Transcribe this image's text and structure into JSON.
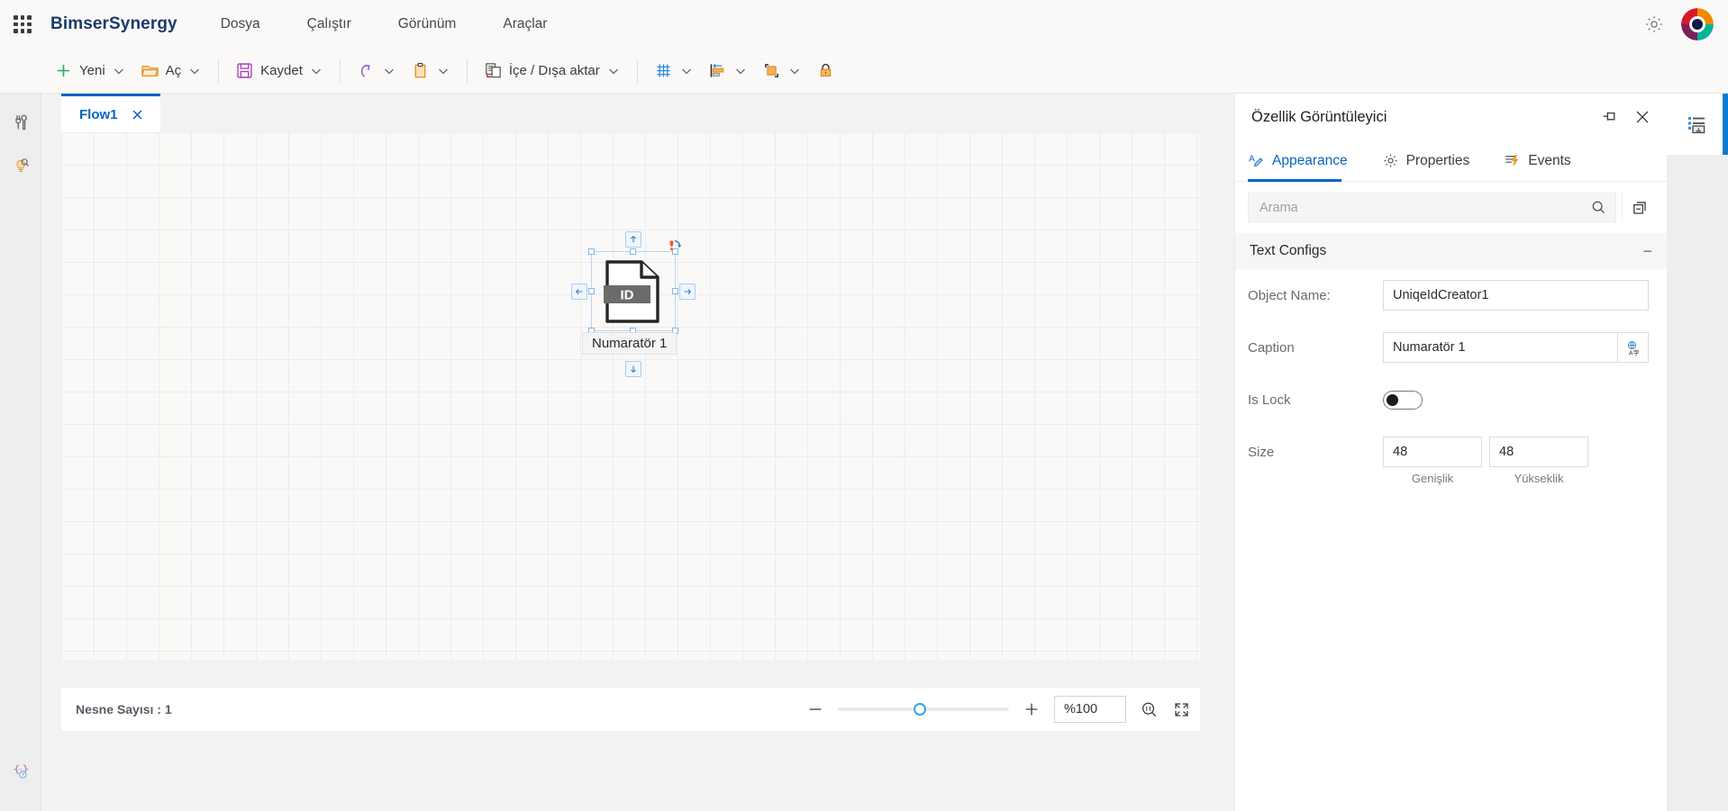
{
  "topbar": {
    "waffle_icon": "app-launcher-grid-icon",
    "brand": "BimserSynergy",
    "menus": [
      {
        "label": "Dosya"
      },
      {
        "label": "Çalıştır"
      },
      {
        "label": "Görünüm"
      },
      {
        "label": "Araçlar"
      }
    ],
    "settings_icon": "gear-icon",
    "avatar_icon": "user-avatar-pinwheel"
  },
  "ribbon": {
    "groups": [
      {
        "items": [
          {
            "label": "Yeni",
            "icon": "plus-icon",
            "caret": true
          },
          {
            "label": "Aç",
            "icon": "folder-open-icon",
            "caret": true
          }
        ]
      },
      {
        "items": [
          {
            "label": "Kaydet",
            "icon": "floppy-save-icon",
            "caret": true
          }
        ]
      },
      {
        "items": [
          {
            "label": "",
            "icon": "undo-icon",
            "caret": true
          },
          {
            "label": "",
            "icon": "clipboard-icon",
            "caret": true
          }
        ]
      },
      {
        "items": [
          {
            "label": "İçe / Dışa aktar",
            "icon": "import-export-icon",
            "caret": true
          }
        ]
      },
      {
        "items": [
          {
            "label": "",
            "icon": "grid-icon",
            "caret": true
          },
          {
            "label": "",
            "icon": "align-left-icon",
            "caret": true
          },
          {
            "label": "",
            "icon": "bring-to-front-icon",
            "caret": true
          },
          {
            "label": "",
            "icon": "lock-icon",
            "caret": false
          }
        ]
      }
    ]
  },
  "left_rail": {
    "items": [
      {
        "icon": "tools-wrench-icon",
        "name": "toolbox"
      },
      {
        "icon": "lightbulb-search-icon",
        "name": "inspector"
      }
    ],
    "bottom": {
      "icon": "code-help-icon",
      "name": "script-help"
    }
  },
  "editor": {
    "tabs": [
      {
        "label": "Flow1",
        "close_icon": "close-icon",
        "active": true
      }
    ],
    "canvas": {
      "grid_visible": true,
      "node": {
        "icon": "document-id-icon",
        "icon_label": "ID",
        "caption": "Numaratör 1",
        "selected": true,
        "handles": 8,
        "rotate_handle_icon": "rotate-icon",
        "connector_arrows": [
          "up",
          "left",
          "right",
          "down"
        ]
      }
    },
    "status": {
      "object_count_label": "Nesne Sayısı : 1",
      "zoom_out_icon": "minus-icon",
      "zoom_in_icon": "plus-icon",
      "zoom_value": "%100",
      "zoom_slider_percent": 44,
      "fit_actual_icon": "zoom-1-1-icon",
      "fit_screen_icon": "fit-to-screen-icon"
    }
  },
  "property_panel": {
    "title": "Özellik Görüntüleyici",
    "pin_icon": "pin-icon",
    "close_icon": "close-icon",
    "tabs": [
      {
        "label": "Appearance",
        "icon": "appearance-pencil-icon",
        "active": true
      },
      {
        "label": "Properties",
        "icon": "gear-icon",
        "active": false
      },
      {
        "label": "Events",
        "icon": "events-lightning-icon",
        "active": false
      }
    ],
    "search": {
      "placeholder": "Arama",
      "value": "",
      "search_icon": "search-icon",
      "collapse_all_icon": "collapse-all-icon"
    },
    "section": {
      "title": "Text Configs",
      "toggle": "−",
      "fields": [
        {
          "label": "Object Name:",
          "type": "text",
          "value": "UniqeIdCreator1"
        },
        {
          "label": "Caption",
          "type": "text-with-button",
          "value": "Numaratör 1",
          "button_icon": "translate-icon"
        },
        {
          "label": "Is Lock",
          "type": "toggle",
          "value": false
        },
        {
          "label": "Size",
          "type": "size",
          "width_value": "48",
          "width_caption": "Genişlik",
          "height_value": "48",
          "height_caption": "Yükseklik"
        }
      ]
    }
  },
  "right_rail": {
    "items": [
      {
        "icon": "properties-list-icon",
        "name": "property-viewer-toggle",
        "active": true
      }
    ],
    "accent_color": "#0a7cd4"
  },
  "colors": {
    "accent": "#0a65c2",
    "brand_text": "#1b3a6b",
    "chrome_bg": "#faf9f8",
    "rail_bg": "#eeeeee",
    "canvas_bg": "#faf9f8"
  }
}
